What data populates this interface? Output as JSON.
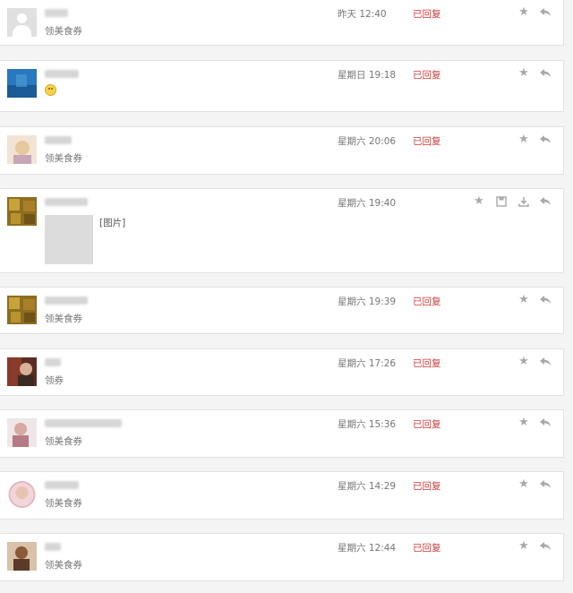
{
  "messages": [
    {
      "time": "昨天 12:40",
      "status": "已回复",
      "text": "领美食券",
      "avatar_color": "#e0e0e0",
      "avatar_type": "default"
    },
    {
      "time": "星期日 19:18",
      "status": "已回复",
      "text": "",
      "emoji": "smile-emoji",
      "avatar_color": "#1f6fb5"
    },
    {
      "time": "星期六 20:06",
      "status": "已回复",
      "text": "领美食券",
      "avatar_color": "#e8c9a4"
    },
    {
      "time": "星期六 19:40",
      "status": "已回复",
      "text": "[图片]",
      "has_image": true,
      "avatar_color": "#9a7a2a"
    },
    {
      "time": "星期六 19:39",
      "status": "已回复",
      "text": "领美食券",
      "avatar_color": "#a0802e"
    },
    {
      "time": "星期六 17:26",
      "status": "已回复",
      "text": "领券",
      "avatar_color": "#6b3a2a"
    },
    {
      "time": "星期六 15:36",
      "status": "已回复",
      "text": "领美食券",
      "avatar_color": "#c9a0a6"
    },
    {
      "time": "星期六 14:29",
      "status": "已回复",
      "text": "领美食券",
      "avatar_color": "#e6c8cc"
    },
    {
      "time": "星期六 12:44",
      "status": "已回复",
      "text": "领美食券",
      "avatar_color": "#8a6a4a"
    }
  ],
  "icons": {
    "star": "star-icon",
    "reply": "reply-icon",
    "save": "save-icon",
    "download": "download-icon"
  },
  "colors": {
    "status": "#d33a3a",
    "icon": "#a9a9a9",
    "card_bg": "#ffffff",
    "page_bg": "#f4f4f4"
  }
}
